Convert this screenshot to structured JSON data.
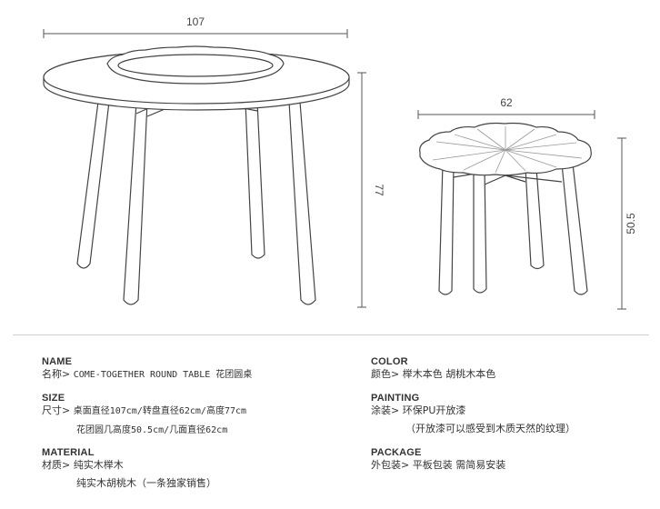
{
  "dimensions": {
    "dining_table_width": "107",
    "dining_table_height": "77",
    "side_table_width": "62",
    "side_table_height": "50.5"
  },
  "specs_left": [
    {
      "heading": "NAME",
      "lines": [
        {
          "label": "名称>",
          "value": "COME-TOGETHER ROUND TABLE  花团圆桌"
        }
      ]
    },
    {
      "heading": "SIZE",
      "lines": [
        {
          "label": "尺寸>",
          "value": "桌面直径107cm/转盘直径62cm/高度77cm"
        },
        {
          "label": "",
          "value": "花团圆几高度50.5cm/几面直径62cm"
        }
      ]
    },
    {
      "heading": "MATERIAL",
      "lines": [
        {
          "label": "材质>",
          "value": "纯实木榉木"
        },
        {
          "label": "",
          "value": "纯实木胡桃木（一条独家销售）"
        }
      ]
    }
  ],
  "specs_right": [
    {
      "heading": "COLOR",
      "lines": [
        {
          "label": "颜色>",
          "value": "榉木本色 胡桃木本色"
        }
      ]
    },
    {
      "heading": "PAINTING",
      "lines": [
        {
          "label": "涂装>",
          "value": "环保PU开放漆"
        },
        {
          "label": "",
          "value": "（开放漆可以感受到木质天然的纹理）"
        }
      ]
    },
    {
      "heading": "PACKAGE",
      "lines": [
        {
          "label": "外包装>",
          "value": "平板包装  需简易安装"
        }
      ]
    }
  ]
}
